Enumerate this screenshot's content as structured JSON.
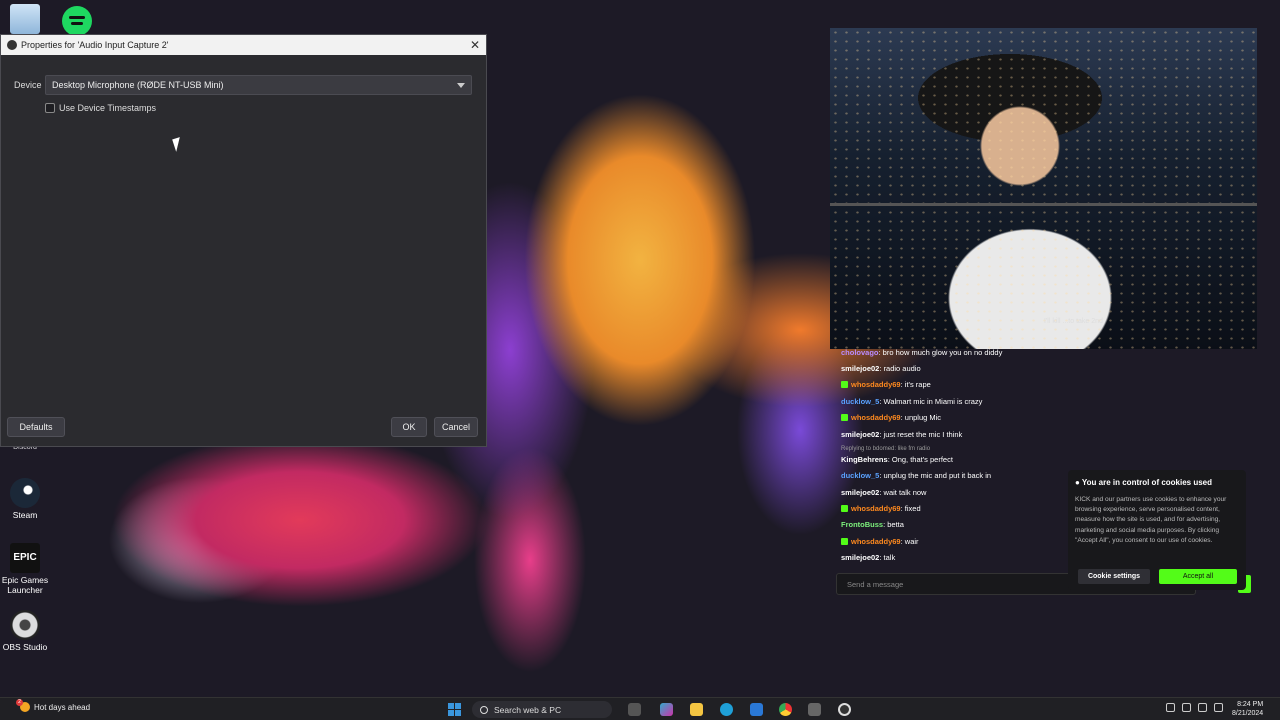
{
  "desktop": {
    "icons": [
      {
        "label": ""
      },
      {
        "label": ""
      },
      {
        "label": "Steam"
      },
      {
        "label": "Epic Games Launcher"
      },
      {
        "label": "OBS Studio"
      }
    ],
    "partial_label": "Discord",
    "epic_glyph": "EPIC"
  },
  "dialog": {
    "title": "Properties for 'Audio Input Capture 2'",
    "close_glyph": "✕",
    "device_label": "Device",
    "device_value": "Desktop Microphone (RØDE NT-USB Mini)",
    "timestamps_label": "Use Device Timestamps",
    "defaults_label": "Defaults",
    "ok_label": "OK",
    "cancel_label": "Cancel"
  },
  "stream": {
    "overlay_text": "I'll kill ...to take 2nd"
  },
  "chat": {
    "messages": [
      {
        "user": "cholovago",
        "text": ": bro how much glow you on no diddy",
        "color": "#b98cff",
        "badge": false
      },
      {
        "user": "smilejoe02",
        "text": ": radio audio",
        "color": "#ffffff",
        "badge": false
      },
      {
        "user": "whosdaddy69",
        "text": ": it's rape",
        "color": "#ff8a1f",
        "badge": true
      },
      {
        "user": "ducklow_5",
        "text": ": Walmart mic in Miami is crazy",
        "color": "#5aa2ff",
        "badge": false
      },
      {
        "user": "whosdaddy69",
        "text": ": unplug Mic",
        "color": "#ff8a1f",
        "badge": true
      },
      {
        "user": "smilejoe02",
        "text": ": just reset the mic I think",
        "color": "#ffffff",
        "badge": false
      },
      {
        "user": "KingBehrens",
        "text": ": Ong, that's perfect",
        "color": "#ffffff",
        "badge": false
      },
      {
        "user": "ducklow_5",
        "text": ": unplug the mic and put it back in",
        "color": "#5aa2ff",
        "badge": false
      },
      {
        "user": "smilejoe02",
        "text": ": wait talk now",
        "color": "#ffffff",
        "badge": false
      },
      {
        "user": "whosdaddy69",
        "text": ": fixed",
        "color": "#ff8a1f",
        "badge": true
      },
      {
        "user": "FrontoBuss",
        "text": ": betta",
        "color": "#7cf07c",
        "badge": false
      },
      {
        "user": "whosdaddy69",
        "text": ": wair",
        "color": "#ff8a1f",
        "badge": true
      },
      {
        "user": "smilejoe02",
        "text": ": talk",
        "color": "#ffffff",
        "badge": false
      }
    ],
    "reply_text": "Replying to bdomed: like fm radio",
    "input_placeholder": "Send a message"
  },
  "cookie": {
    "title": "You are in control of cookies used",
    "body": "KICK and our partners use cookies to enhance your browsing experience, serve personalised content, measure how the site is used, and for advertising, marketing and social media purposes. By clicking \"Accept All\", you consent to our use of cookies.",
    "settings_label": "Cookie settings",
    "accept_label": "Accept all"
  },
  "taskbar": {
    "weather_text": "Hot days ahead",
    "notification_count": "2",
    "search_placeholder": "Search web & PC",
    "time": "8:24 PM",
    "date": "8/21/2024"
  },
  "colors": {
    "kick_green": "#53fc18",
    "dialog_bg": "#2b2b2f"
  }
}
